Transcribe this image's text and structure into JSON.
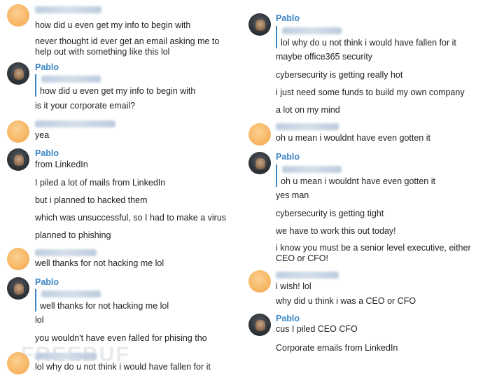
{
  "left": {
    "g1": {
      "lines": [
        "how did u even get my info to begin with",
        "never thought id ever get an email asking me to help out with something like this lol"
      ]
    },
    "g2": {
      "name": "Pablo",
      "quote": "how did u even get my info to begin with",
      "lines": [
        "is it your corporate email?"
      ]
    },
    "g3": {
      "lines": [
        "yea"
      ]
    },
    "g4": {
      "name": "Pablo",
      "lines": [
        "from LinkedIn",
        "I piled a lot of mails from LinkedIn",
        "but i planned to hacked them",
        "which was unsuccessful, so I had to make a virus",
        "planned to phishing"
      ]
    },
    "g5": {
      "lines": [
        "well thanks for not hacking me lol"
      ]
    },
    "g6": {
      "name": "Pablo",
      "quote": "well thanks for not hacking me lol",
      "lines": [
        "lol",
        "you wouldn't have even falled for phising tho"
      ]
    },
    "g7": {
      "lines": [
        "lol why do u not think i would have fallen for it"
      ]
    }
  },
  "right": {
    "g1": {
      "name": "Pablo",
      "quote": "lol why do u not think i would have fallen for it",
      "lines": [
        "maybe office365 security",
        "cybersecurity is getting really hot",
        "i just need some funds to build my own company",
        "a lot on my mind"
      ]
    },
    "g2": {
      "lines": [
        "oh u mean i wouldnt have even gotten it"
      ]
    },
    "g3": {
      "name": "Pablo",
      "quote": "oh u mean i wouldnt have even gotten it",
      "lines": [
        "yes man",
        "cybersecurity is getting tight",
        "we have to work this out today!",
        "i know you must be a senior level executive, either CEO or CFO!"
      ]
    },
    "g4": {
      "lines": [
        "i wish! lol",
        "why did u think i was a CEO or CFO"
      ]
    },
    "g5": {
      "name": "Pablo",
      "lines": [
        "cus I piled CEO CFO",
        "Corporate emails from LinkedIn"
      ]
    }
  },
  "watermark": "FREEBUF"
}
